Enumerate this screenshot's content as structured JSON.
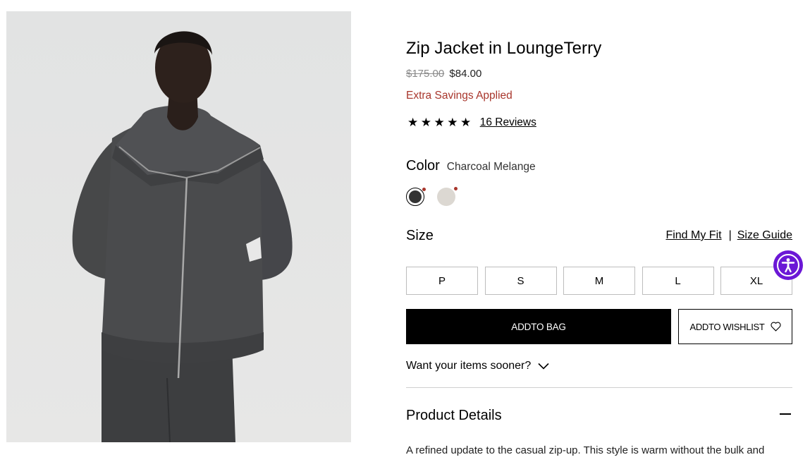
{
  "product": {
    "image_alt": "Model wearing charcoal zip jacket",
    "title": "Zip Jacket in LoungeTerry",
    "price_original": "$175.00",
    "price_sale": "$84.00",
    "savings_note": "Extra Savings Applied",
    "stars": "★★★★★",
    "reviews_link": "16 Reviews"
  },
  "color": {
    "label": "Color",
    "selected_name": "Charcoal Melange",
    "swatches": [
      {
        "name": "Charcoal Melange",
        "hex": "#333333",
        "selected": true
      },
      {
        "name": "Light Heather",
        "hex": "#dcd8d2",
        "selected": false
      }
    ]
  },
  "size": {
    "label": "Size",
    "find_fit_link": "Find My Fit",
    "separator": "|",
    "size_guide_link": "Size Guide",
    "options": [
      "P",
      "S",
      "M",
      "L",
      "XL"
    ]
  },
  "actions": {
    "add_to_bag": "ADDTO BAG",
    "add_to_wishlist": "ADDTO WISHLIST"
  },
  "shipping": {
    "sooner_label": "Want your items sooner?"
  },
  "details": {
    "title": "Product Details",
    "text": "A refined update to the casual zip-up. This style is warm without the bulk and"
  },
  "colors": {
    "sale_red": "#a8362c",
    "accessibility_purple": "#6b17d6"
  }
}
